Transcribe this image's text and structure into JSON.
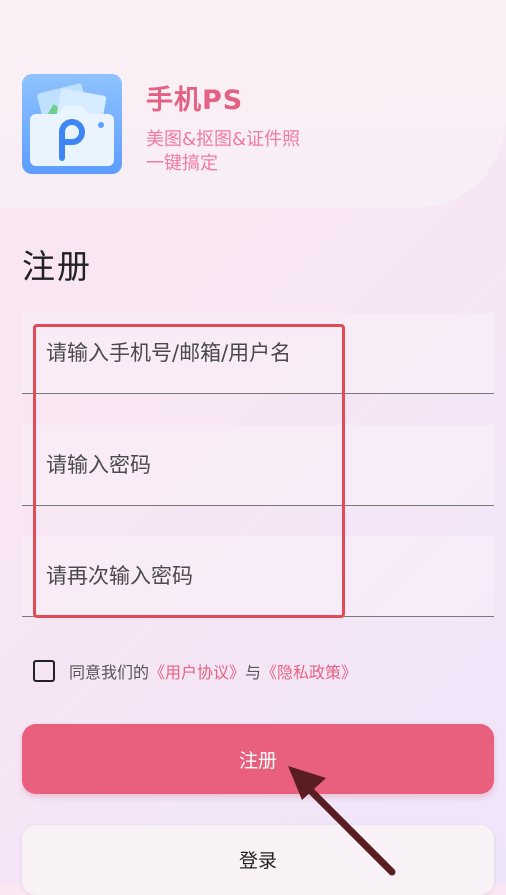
{
  "app": {
    "name": "手机PS",
    "slogan_line1": "美图&抠图&证件照",
    "slogan_line2": "一键搞定"
  },
  "page": {
    "title": "注册"
  },
  "form": {
    "account_placeholder": "请输入手机号/邮箱/用户名",
    "password_placeholder": "请输入密码",
    "confirm_placeholder": "请再次输入密码"
  },
  "agreement": {
    "prefix": "同意我们的",
    "user_agreement": "《用户协议》",
    "joiner": "与",
    "privacy_policy": "《隐私政策》",
    "checked": false
  },
  "buttons": {
    "register": "注册",
    "login": "登录"
  },
  "colors": {
    "accent": "#e8607c",
    "highlight": "#e04b55",
    "app_icon": "#5d9dff"
  }
}
